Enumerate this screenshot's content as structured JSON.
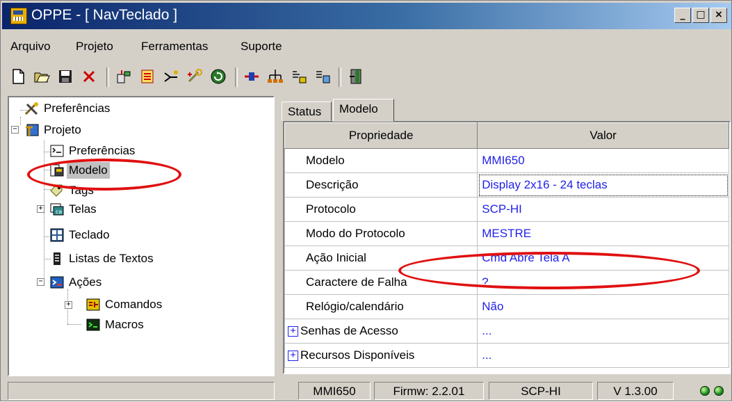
{
  "window": {
    "title": "OPPE - [ NavTeclado ]",
    "controls": {
      "minimize": "_",
      "restore": "□",
      "close": "×"
    }
  },
  "menu": {
    "items": [
      "Arquivo",
      "Projeto",
      "Ferramentas",
      "Suporte"
    ]
  },
  "toolbar": {
    "buttons": [
      "new-icon",
      "open-icon",
      "save-icon",
      "delete-icon",
      "compile-icon",
      "download-icon",
      "debug-icon",
      "config-icon",
      "refresh-icon",
      "connect-icon",
      "network-icon",
      "keyboard-icon",
      "screens-icon",
      "exit-icon"
    ]
  },
  "tree": {
    "items": [
      {
        "label": "Preferências",
        "icon": "preferences-tools-icon"
      },
      {
        "label": "Projeto",
        "icon": "project-icon"
      },
      {
        "label": "Preferências",
        "icon": "project-preferences-icon"
      },
      {
        "label": "Modelo",
        "icon": "model-icon"
      },
      {
        "label": "Tags",
        "icon": "tags-icon"
      },
      {
        "label": "Telas",
        "icon": "screens-icon"
      },
      {
        "label": "Teclado",
        "icon": "keyboard-icon"
      },
      {
        "label": "Listas de Textos",
        "icon": "text-list-icon"
      },
      {
        "label": "Ações",
        "icon": "actions-icon"
      },
      {
        "label": "Comandos",
        "icon": "commands-icon"
      },
      {
        "label": "Macros",
        "icon": "macros-icon"
      }
    ],
    "selected": "Modelo"
  },
  "tabs": [
    {
      "label": "Status",
      "active": false
    },
    {
      "label": "Modelo",
      "active": true
    }
  ],
  "grid": {
    "headers": [
      "Propriedade",
      "Valor"
    ],
    "rows": [
      {
        "name": "Modelo",
        "value": "MMI650"
      },
      {
        "name": "Descrição",
        "value": "Display 2x16 - 24 teclas",
        "selected": true
      },
      {
        "name": "Protocolo",
        "value": "SCP-HI"
      },
      {
        "name": "Modo do Protocolo",
        "value": "MESTRE"
      },
      {
        "name": "Ação Inicial",
        "value": "Cmd Abre Tela A"
      },
      {
        "name": "Caractere de Falha",
        "value": "?"
      },
      {
        "name": "Relógio/calendário",
        "value": "Não"
      },
      {
        "name": "Senhas de Acesso",
        "value": "...",
        "expandable": true
      },
      {
        "name": "Recursos Disponíveis",
        "value": "...",
        "expandable": true
      }
    ]
  },
  "status": {
    "model": "MMI650",
    "firmware": "Firmw: 2.2.01",
    "protocol": "SCP-HI",
    "version": "V 1.3.00",
    "leds": [
      "green",
      "green"
    ]
  },
  "colors": {
    "value_text": "#1f1fe8",
    "selected_value_text": "#a8141a",
    "annotation": "#e01010",
    "titlebar": "#0a246a"
  }
}
